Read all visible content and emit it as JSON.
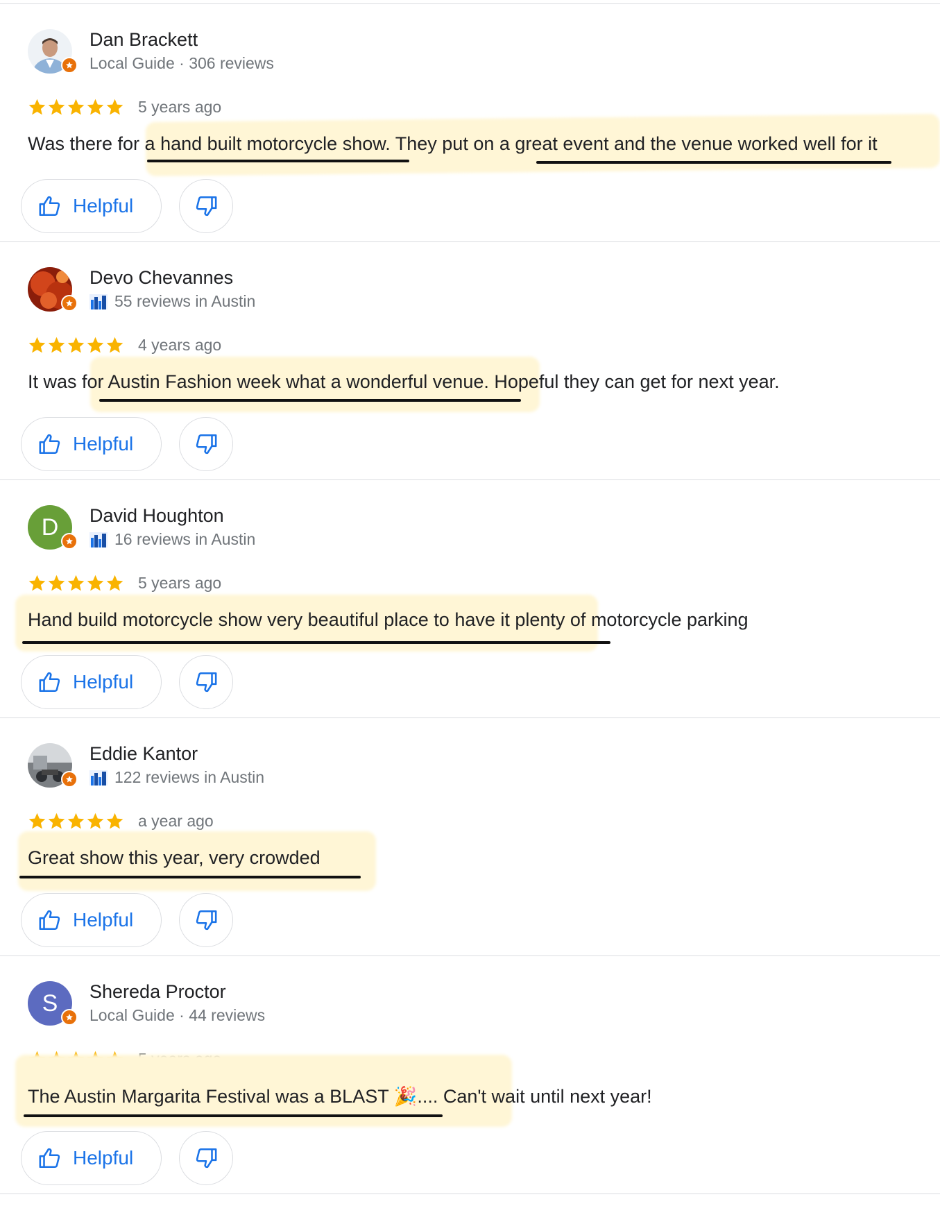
{
  "colors": {
    "star": "#f9b300",
    "link": "#1a73e8",
    "badge": "#e8710a",
    "highlight": "#fff6d6"
  },
  "reviews": [
    {
      "name": "Dan Brackett",
      "meta": "Local Guide · 306 reviews",
      "meta_icon": null,
      "avatar": {
        "type": "photo",
        "letter": ""
      },
      "stars": 5,
      "time": "5 years ago",
      "text": "Was there for a hand built motorcycle show. They put on a great event and the venue worked well for it",
      "helpful_label": "Helpful"
    },
    {
      "name": "Devo Chevannes",
      "meta": "55 reviews in Austin",
      "meta_icon": "city-icon",
      "avatar": {
        "type": "photo",
        "letter": ""
      },
      "stars": 5,
      "time": "4 years ago",
      "text": "It was for Austin Fashion week what a wonderful venue. Hopeful they can get for next year.",
      "helpful_label": "Helpful"
    },
    {
      "name": "David Houghton",
      "meta": "16 reviews in Austin",
      "meta_icon": "city-icon",
      "avatar": {
        "type": "letter",
        "letter": "D",
        "color": "#689f38"
      },
      "stars": 5,
      "time": "5 years ago",
      "text": "Hand build motorcycle show very beautiful place to have it plenty of motorcycle parking",
      "helpful_label": "Helpful"
    },
    {
      "name": "Eddie Kantor",
      "meta": "122 reviews in Austin",
      "meta_icon": "city-icon",
      "avatar": {
        "type": "photo",
        "letter": ""
      },
      "stars": 5,
      "time": "a year ago",
      "text": "Great show this year, very crowded",
      "helpful_label": "Helpful"
    },
    {
      "name": "Shereda Proctor",
      "meta": "Local Guide · 44 reviews",
      "meta_icon": null,
      "avatar": {
        "type": "letter",
        "letter": "S",
        "color": "#5c6bc0"
      },
      "stars": 5,
      "time": "5 years ago",
      "text_before": "The Austin Margarita Festival was a BLAST ",
      "emoji": "🎉",
      "text_after": ".... Can't wait until next year!",
      "helpful_label": "Helpful"
    }
  ]
}
